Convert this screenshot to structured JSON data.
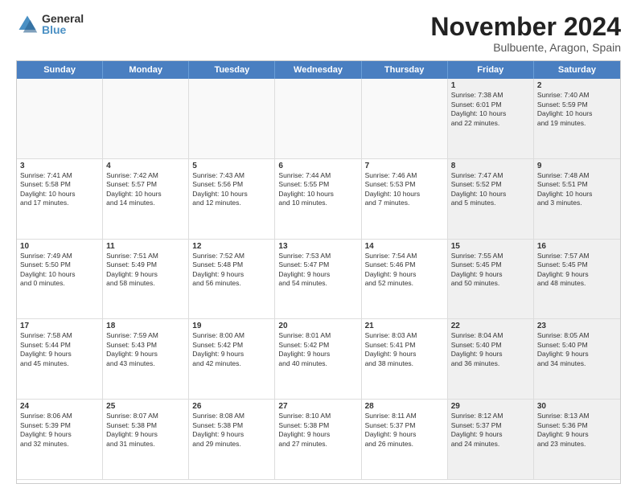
{
  "logo": {
    "general": "General",
    "blue": "Blue"
  },
  "title": "November 2024",
  "location": "Bulbuente, Aragon, Spain",
  "days": [
    "Sunday",
    "Monday",
    "Tuesday",
    "Wednesday",
    "Thursday",
    "Friday",
    "Saturday"
  ],
  "cells": [
    {
      "day": "",
      "info": "",
      "empty": true
    },
    {
      "day": "",
      "info": "",
      "empty": true
    },
    {
      "day": "",
      "info": "",
      "empty": true
    },
    {
      "day": "",
      "info": "",
      "empty": true
    },
    {
      "day": "",
      "info": "",
      "empty": true
    },
    {
      "day": "1",
      "info": "Sunrise: 7:38 AM\nSunset: 6:01 PM\nDaylight: 10 hours\nand 22 minutes.",
      "shaded": true
    },
    {
      "day": "2",
      "info": "Sunrise: 7:40 AM\nSunset: 5:59 PM\nDaylight: 10 hours\nand 19 minutes.",
      "shaded": true
    },
    {
      "day": "3",
      "info": "Sunrise: 7:41 AM\nSunset: 5:58 PM\nDaylight: 10 hours\nand 17 minutes."
    },
    {
      "day": "4",
      "info": "Sunrise: 7:42 AM\nSunset: 5:57 PM\nDaylight: 10 hours\nand 14 minutes."
    },
    {
      "day": "5",
      "info": "Sunrise: 7:43 AM\nSunset: 5:56 PM\nDaylight: 10 hours\nand 12 minutes."
    },
    {
      "day": "6",
      "info": "Sunrise: 7:44 AM\nSunset: 5:55 PM\nDaylight: 10 hours\nand 10 minutes."
    },
    {
      "day": "7",
      "info": "Sunrise: 7:46 AM\nSunset: 5:53 PM\nDaylight: 10 hours\nand 7 minutes."
    },
    {
      "day": "8",
      "info": "Sunrise: 7:47 AM\nSunset: 5:52 PM\nDaylight: 10 hours\nand 5 minutes.",
      "shaded": true
    },
    {
      "day": "9",
      "info": "Sunrise: 7:48 AM\nSunset: 5:51 PM\nDaylight: 10 hours\nand 3 minutes.",
      "shaded": true
    },
    {
      "day": "10",
      "info": "Sunrise: 7:49 AM\nSunset: 5:50 PM\nDaylight: 10 hours\nand 0 minutes."
    },
    {
      "day": "11",
      "info": "Sunrise: 7:51 AM\nSunset: 5:49 PM\nDaylight: 9 hours\nand 58 minutes."
    },
    {
      "day": "12",
      "info": "Sunrise: 7:52 AM\nSunset: 5:48 PM\nDaylight: 9 hours\nand 56 minutes."
    },
    {
      "day": "13",
      "info": "Sunrise: 7:53 AM\nSunset: 5:47 PM\nDaylight: 9 hours\nand 54 minutes."
    },
    {
      "day": "14",
      "info": "Sunrise: 7:54 AM\nSunset: 5:46 PM\nDaylight: 9 hours\nand 52 minutes."
    },
    {
      "day": "15",
      "info": "Sunrise: 7:55 AM\nSunset: 5:45 PM\nDaylight: 9 hours\nand 50 minutes.",
      "shaded": true
    },
    {
      "day": "16",
      "info": "Sunrise: 7:57 AM\nSunset: 5:45 PM\nDaylight: 9 hours\nand 48 minutes.",
      "shaded": true
    },
    {
      "day": "17",
      "info": "Sunrise: 7:58 AM\nSunset: 5:44 PM\nDaylight: 9 hours\nand 45 minutes."
    },
    {
      "day": "18",
      "info": "Sunrise: 7:59 AM\nSunset: 5:43 PM\nDaylight: 9 hours\nand 43 minutes."
    },
    {
      "day": "19",
      "info": "Sunrise: 8:00 AM\nSunset: 5:42 PM\nDaylight: 9 hours\nand 42 minutes."
    },
    {
      "day": "20",
      "info": "Sunrise: 8:01 AM\nSunset: 5:42 PM\nDaylight: 9 hours\nand 40 minutes."
    },
    {
      "day": "21",
      "info": "Sunrise: 8:03 AM\nSunset: 5:41 PM\nDaylight: 9 hours\nand 38 minutes."
    },
    {
      "day": "22",
      "info": "Sunrise: 8:04 AM\nSunset: 5:40 PM\nDaylight: 9 hours\nand 36 minutes.",
      "shaded": true
    },
    {
      "day": "23",
      "info": "Sunrise: 8:05 AM\nSunset: 5:40 PM\nDaylight: 9 hours\nand 34 minutes.",
      "shaded": true
    },
    {
      "day": "24",
      "info": "Sunrise: 8:06 AM\nSunset: 5:39 PM\nDaylight: 9 hours\nand 32 minutes."
    },
    {
      "day": "25",
      "info": "Sunrise: 8:07 AM\nSunset: 5:38 PM\nDaylight: 9 hours\nand 31 minutes."
    },
    {
      "day": "26",
      "info": "Sunrise: 8:08 AM\nSunset: 5:38 PM\nDaylight: 9 hours\nand 29 minutes."
    },
    {
      "day": "27",
      "info": "Sunrise: 8:10 AM\nSunset: 5:38 PM\nDaylight: 9 hours\nand 27 minutes."
    },
    {
      "day": "28",
      "info": "Sunrise: 8:11 AM\nSunset: 5:37 PM\nDaylight: 9 hours\nand 26 minutes."
    },
    {
      "day": "29",
      "info": "Sunrise: 8:12 AM\nSunset: 5:37 PM\nDaylight: 9 hours\nand 24 minutes.",
      "shaded": true
    },
    {
      "day": "30",
      "info": "Sunrise: 8:13 AM\nSunset: 5:36 PM\nDaylight: 9 hours\nand 23 minutes.",
      "shaded": true
    }
  ]
}
